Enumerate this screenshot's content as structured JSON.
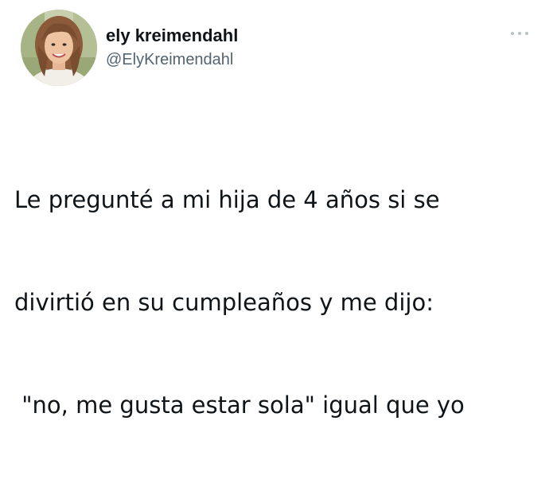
{
  "author": {
    "display_name": "ely kreimendahl",
    "handle": "@ElyKreimendahl",
    "avatar_icon": "profile-photo"
  },
  "menu": {
    "icon": "more-options-icon"
  },
  "tweet": {
    "lines": [
      "Le pregunté a mi hija de 4 años si se",
      "divirtió en su cumpleaños y me dijo:",
      " \"no, me gusta estar sola\" igual que yo"
    ]
  }
}
